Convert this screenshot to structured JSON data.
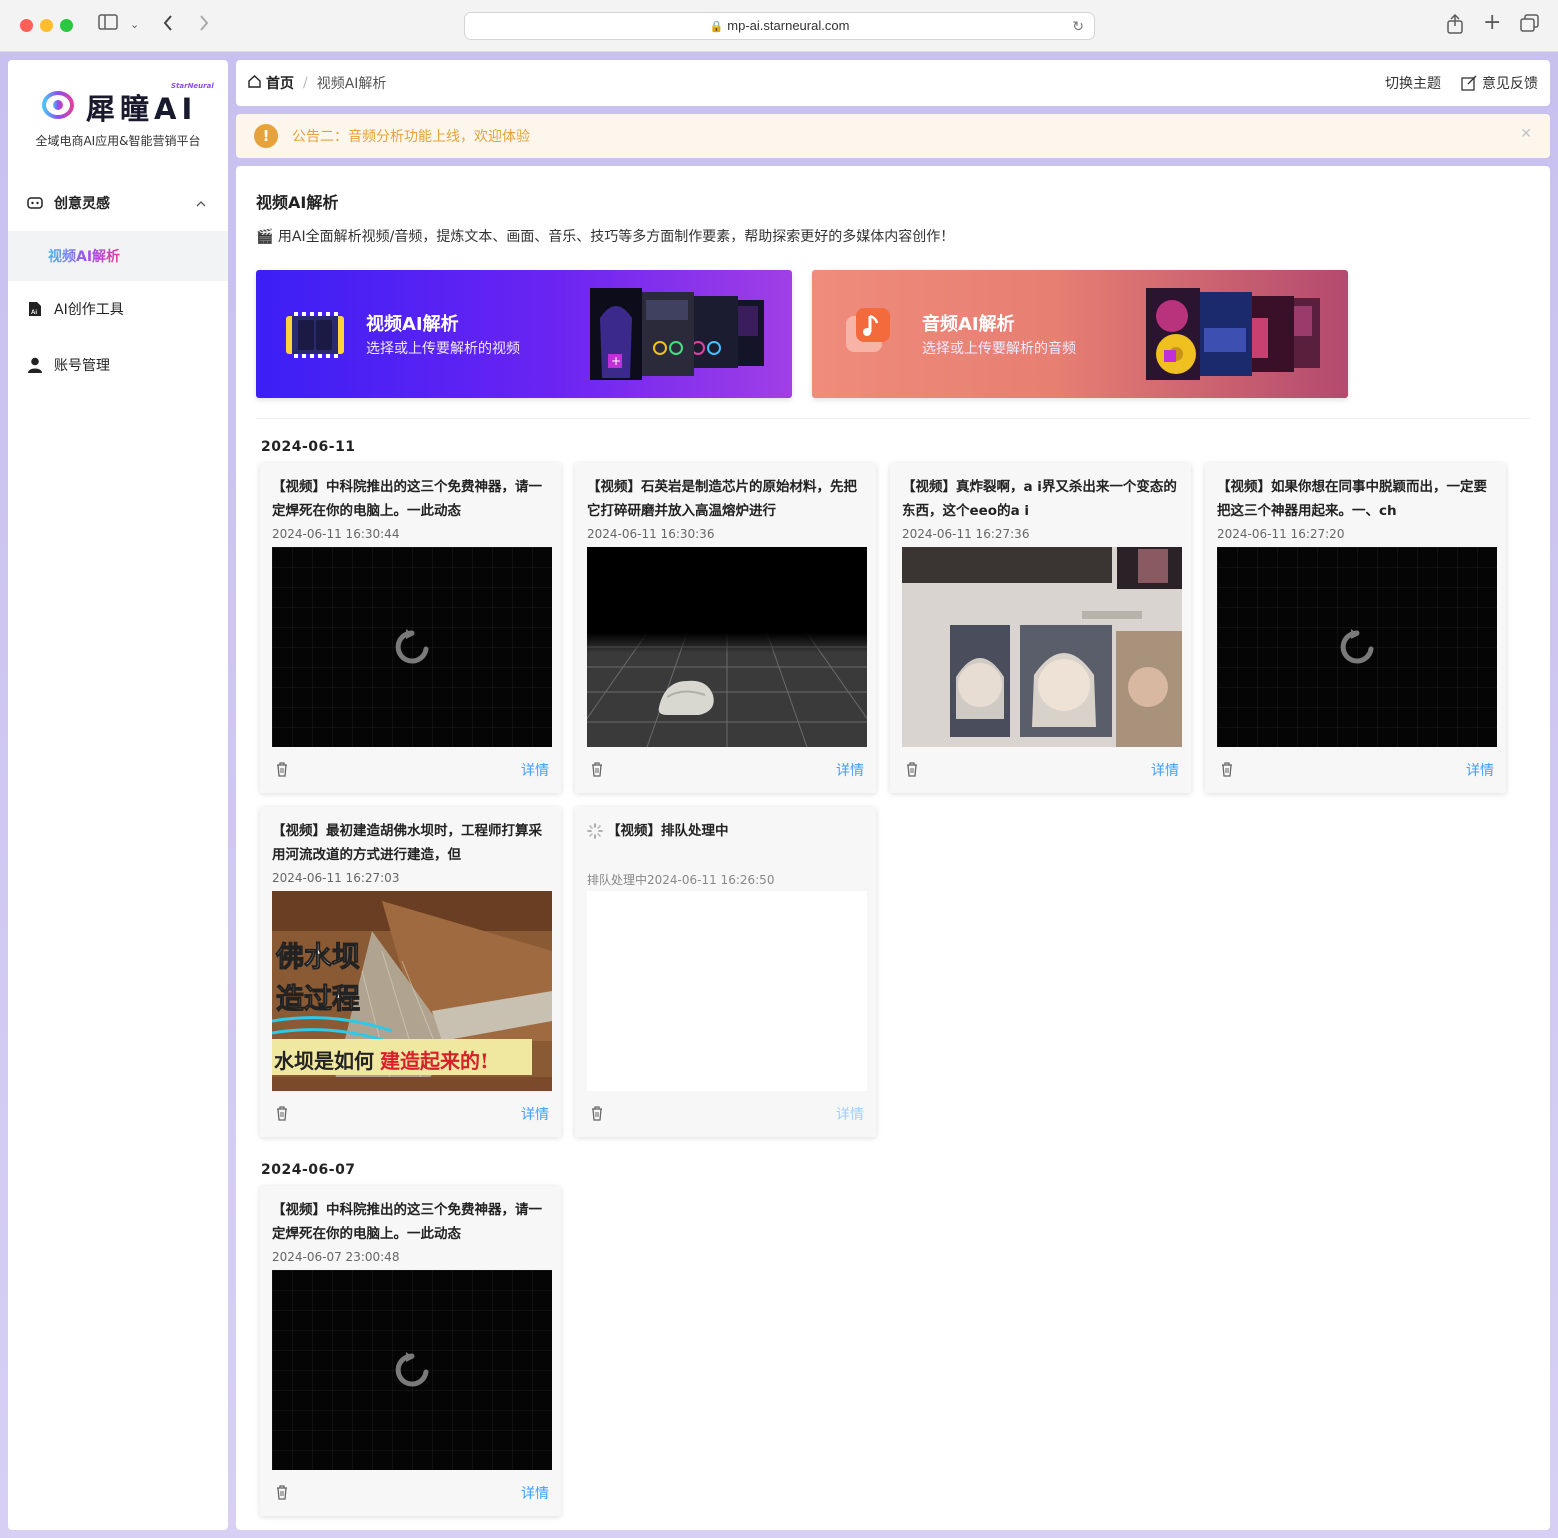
{
  "browser": {
    "url": "mp-ai.starneural.com"
  },
  "brand": {
    "name": "犀瞳AI",
    "super": "StarNeural",
    "tagline": "全域电商AI应用&智能营销平台"
  },
  "sidebar": {
    "items": [
      {
        "label": "创意灵感",
        "icon": "robot-icon",
        "expanded": true
      },
      {
        "label": "视频AI解析",
        "active": true
      },
      {
        "label": "AI创作工具",
        "icon": "ai-file-icon"
      },
      {
        "label": "账号管理",
        "icon": "user-icon"
      }
    ]
  },
  "breadcrumb": {
    "home": "首页",
    "current": "视频AI解析"
  },
  "header": {
    "theme_label": "切换主题",
    "feedback_label": "意见反馈"
  },
  "notice": {
    "text": "公告二：音频分析功能上线，欢迎体验"
  },
  "page": {
    "title": "视频AI解析",
    "emoji": "🎬",
    "description": "用AI全面解析视频/音频，提炼文本、画面、音乐、技巧等多方面制作要素，帮助探索更好的多媒体内容创作！"
  },
  "banners": {
    "video": {
      "title": "视频AI解析",
      "subtitle": "选择或上传要解析的视频"
    },
    "audio": {
      "title": "音频AI解析",
      "subtitle": "选择或上传要解析的音频"
    }
  },
  "groups": [
    {
      "date": "2024-06-11",
      "cards": [
        {
          "title": "【视频】中科院推出的这三个免费神器，请一定焊死在你的电脑上。一此动态",
          "time": "2024-06-11 16:30:44",
          "thumb": "loading",
          "detail": "详情"
        },
        {
          "title": "【视频】石英岩是制造芯片的原始材料，先把它打碎研磨并放入高温熔炉进行",
          "time": "2024-06-11 16:30:36",
          "thumb": "rock",
          "detail": "详情"
        },
        {
          "title": "【视频】真炸裂啊，a i界又杀出来一个变态的东西，这个eeo的a i",
          "time": "2024-06-11 16:27:36",
          "thumb": "screens",
          "detail": "详情"
        },
        {
          "title": "【视频】如果你想在同事中脱颖而出，一定要把这三个神器用起来。一、ch",
          "time": "2024-06-11 16:27:20",
          "thumb": "loading",
          "detail": "详情"
        },
        {
          "title": "【视频】最初建造胡佛水坝时，工程师打算采用河流改道的方式进行建造，但",
          "time": "2024-06-11 16:27:03",
          "thumb": "dam",
          "detail": "详情",
          "thumb_text": [
            "佛水坝",
            "造过程",
            "水坝是如何",
            "建造起来的!"
          ]
        },
        {
          "title": "【视频】排队处理中",
          "time": "排队处理中2024-06-11 16:26:50",
          "thumb": "blank",
          "detail": "详情",
          "pending": true
        }
      ]
    },
    {
      "date": "2024-06-07",
      "cards": [
        {
          "title": "【视频】中科院推出的这三个免费神器，请一定焊死在你的电脑上。一此动态",
          "time": "2024-06-07 23:00:48",
          "thumb": "loading",
          "detail": "详情"
        }
      ]
    }
  ],
  "colors": {
    "accent": "#409eff",
    "warning": "#e6a23c",
    "video_banner": "#4a1ff3",
    "audio_banner": "#e77f72"
  }
}
